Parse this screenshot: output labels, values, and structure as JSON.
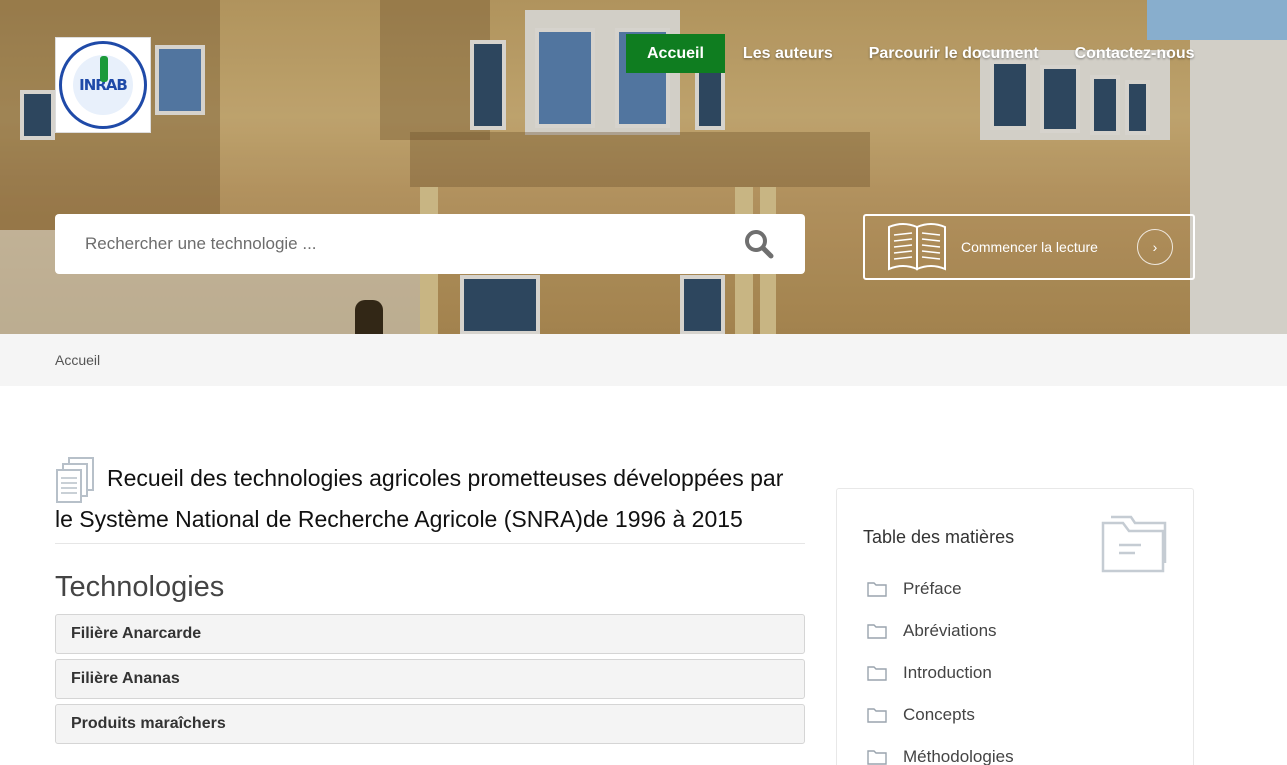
{
  "header": {
    "nav": [
      {
        "label": "Accueil",
        "active": true
      },
      {
        "label": "Les auteurs",
        "active": false
      },
      {
        "label": "Parcourir le document",
        "active": false
      },
      {
        "label": "Contactez-nous",
        "active": false
      }
    ],
    "logo_text": "INRAB",
    "search": {
      "placeholder": "Rechercher une technologie ..."
    },
    "read_button": {
      "label": "Commencer la lecture"
    }
  },
  "breadcrumb": {
    "items": [
      "Accueil"
    ]
  },
  "main": {
    "title": "Recueil des technologies agricoles prometteuses développées par le Système National de Recherche Agricole (SNRA)de 1996 à 2015",
    "section_heading": "Technologies",
    "accordion": [
      {
        "label": "Filière Anarcarde"
      },
      {
        "label": "Filière Ananas"
      },
      {
        "label": "Produits maraîchers"
      }
    ]
  },
  "sidebar": {
    "title": "Table des matières",
    "items": [
      {
        "label": "Préface"
      },
      {
        "label": "Abréviations"
      },
      {
        "label": "Introduction"
      },
      {
        "label": "Concepts"
      },
      {
        "label": "Méthodologies"
      }
    ]
  },
  "colors": {
    "accent": "#0f7d20",
    "breadcrumb_bg": "#f5f5f5",
    "icon_gray": "#b7c0c9"
  },
  "icons": [
    "search-icon",
    "book-icon",
    "chevron-right-icon",
    "documents-icon",
    "folder-icon"
  ]
}
